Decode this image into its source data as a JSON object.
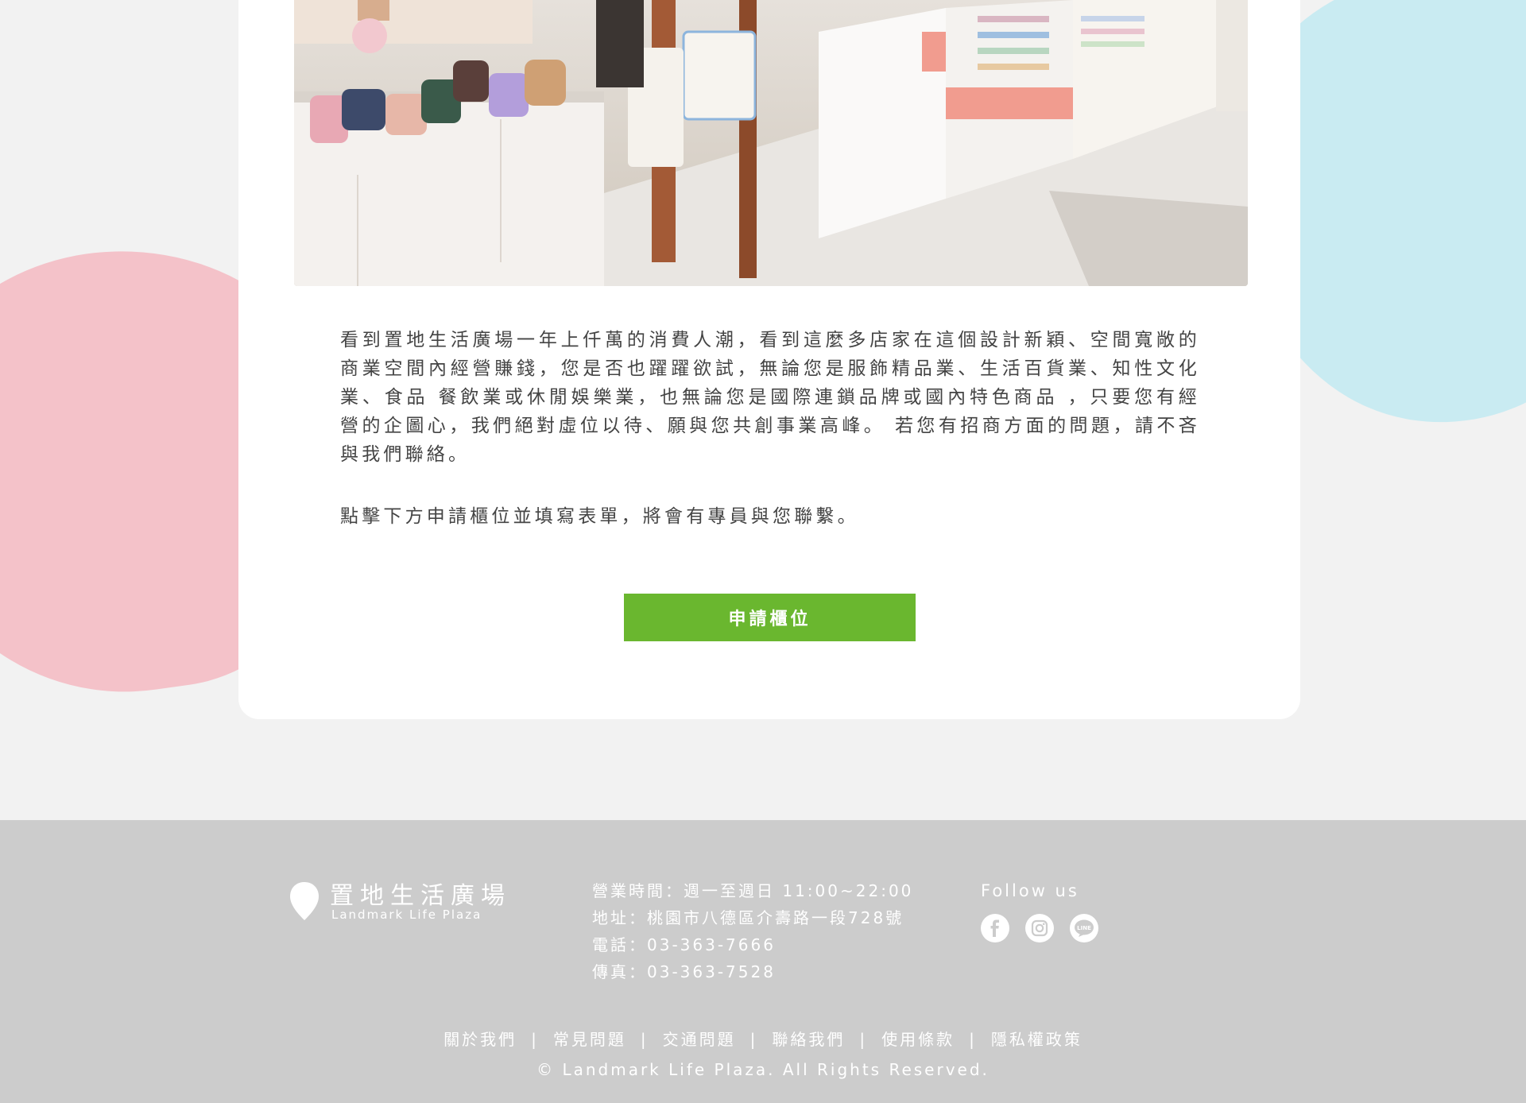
{
  "content": {
    "description": "看到置地生活廣場一年上仟萬的消費人潮，看到這麼多店家在這個設計新穎、空間寬敞的商業空間內經營賺錢，您是否也躍躍欲試，無論您是服飾精品業、生活百貨業、知性文化業、食品 餐飲業或休閒娛樂業，也無論您是國際連鎖品牌或國內特色商品 ，只要您有經營的企圖心，我們絕對虛位以待、願與您共創事業高峰。  若您有招商方面的問題，請不吝與我們聯絡。",
    "note": "點擊下方申請櫃位並填寫表單，將會有專員與您聯繫。",
    "apply_button": "申請櫃位"
  },
  "colors": {
    "button": "#6ab72f",
    "blob_pink": "#f4c2c9",
    "blob_blue": "#c9ebf2",
    "footer_bg": "#cccccc"
  },
  "footer": {
    "logo": {
      "name_cn": "置地生活廣場",
      "name_en": "Landmark Life Plaza"
    },
    "hours": "營業時間：週一至週日 11:00~22:00",
    "address": "地址：桃園市八德區介壽路一段728號",
    "phone": "電話：03-363-7666",
    "fax": "傳真：03-363-7528",
    "follow_title": "Follow us",
    "social": [
      "facebook-icon",
      "instagram-icon",
      "line-icon"
    ],
    "links": [
      "關於我們",
      "常見問題",
      "交通問題",
      "聯絡我們",
      "使用條款",
      "隱私權政策"
    ],
    "separator": "|",
    "copyright": "© Landmark Life Plaza. All Rights Reserved."
  }
}
